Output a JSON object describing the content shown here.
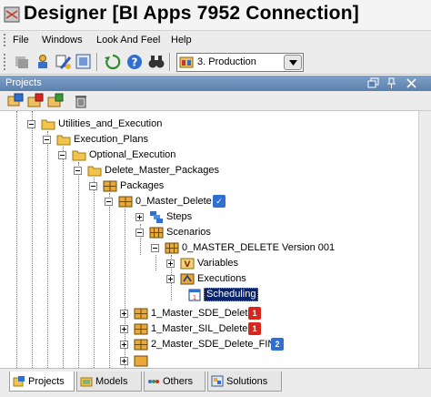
{
  "window": {
    "title": "Designer [BI Apps 7952 Connection]"
  },
  "menu": [
    {
      "label": "File"
    },
    {
      "label": "Windows"
    },
    {
      "label": "Look And Feel"
    },
    {
      "label": "Help"
    }
  ],
  "toolbar": {
    "context_value": "3. Production"
  },
  "panel": {
    "title": "Projects"
  },
  "tree": [
    {
      "label": "Utilities_and_Execution",
      "icon": "folder-icon"
    },
    {
      "label": "Execution_Plans",
      "icon": "folder-icon"
    },
    {
      "label": "Optional_Execution",
      "icon": "folder-icon"
    },
    {
      "label": "Delete_Master_Packages",
      "icon": "folder-icon"
    },
    {
      "label": "Packages",
      "icon": "packages-icon"
    },
    {
      "label": "0_Master_Delete",
      "icon": "package-icon",
      "badge": "✓",
      "badge_color": "#2f6fcf"
    },
    {
      "label": "Steps",
      "icon": "steps-icon"
    },
    {
      "label": "Scenarios",
      "icon": "scenarios-icon"
    },
    {
      "label": "0_MASTER_DELETE Version 001",
      "icon": "scenario-icon"
    },
    {
      "label": "Variables",
      "icon": "variables-icon"
    },
    {
      "label": "Executions",
      "icon": "executions-icon"
    },
    {
      "label": "Scheduling",
      "icon": "scheduling-icon",
      "selected": true
    },
    {
      "label": "1_Master_SDE_Delete",
      "icon": "package-icon",
      "badge": "1",
      "badge_color": "#d9261c"
    },
    {
      "label": "1_Master_SIL_Delete",
      "icon": "package-icon",
      "badge": "1",
      "badge_color": "#d9261c"
    },
    {
      "label": "2_Master_SDE_Delete_FIN",
      "icon": "package-icon",
      "badge": "2",
      "badge_color": "#2f6fcf"
    }
  ],
  "tabs": [
    {
      "label": "Projects",
      "active": true
    },
    {
      "label": "Models"
    },
    {
      "label": "Others"
    },
    {
      "label": "Solutions"
    }
  ]
}
